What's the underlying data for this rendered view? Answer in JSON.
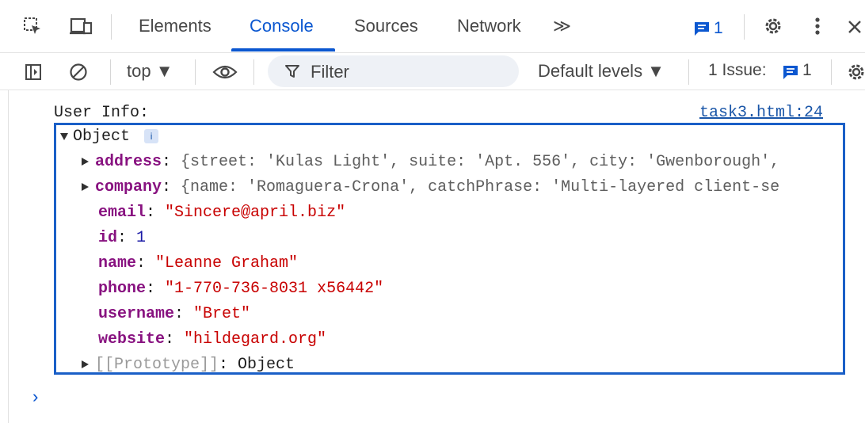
{
  "tabbar": {
    "tabs": [
      "Elements",
      "Console",
      "Sources",
      "Network"
    ],
    "active_tab": "Console",
    "more_tabs": "≫",
    "messages_count": "1"
  },
  "toolbar": {
    "context": "top ▼",
    "filter_placeholder": "Filter",
    "levels": "Default levels ▼",
    "issues_label": "1 Issue:",
    "issues_count": "1"
  },
  "console": {
    "log_label": "User Info:",
    "source_link": "task3.html:24",
    "object": {
      "header": "Object",
      "info_badge": "i",
      "address": {
        "key": "address",
        "preview": "{street: 'Kulas Light', suite: 'Apt. 556', city: 'Gwenborough',"
      },
      "company": {
        "key": "company",
        "preview": "{name: 'Romaguera-Crona', catchPhrase: 'Multi-layered client-se"
      },
      "email": {
        "key": "email",
        "value": "\"Sincere@april.biz\""
      },
      "id": {
        "key": "id",
        "value": "1"
      },
      "name": {
        "key": "name",
        "value": "\"Leanne Graham\""
      },
      "phone": {
        "key": "phone",
        "value": "\"1-770-736-8031 x56442\""
      },
      "username": {
        "key": "username",
        "value": "\"Bret\""
      },
      "website": {
        "key": "website",
        "value": "\"hildegard.org\""
      },
      "prototype": {
        "key": "[[Prototype]]",
        "value": "Object"
      }
    },
    "prompt": "›"
  },
  "colors": {
    "accent": "#0b57d0",
    "key": "#881280",
    "string": "#c80000",
    "number": "#1a1aa6",
    "highlight_border": "#1a5fc7"
  }
}
